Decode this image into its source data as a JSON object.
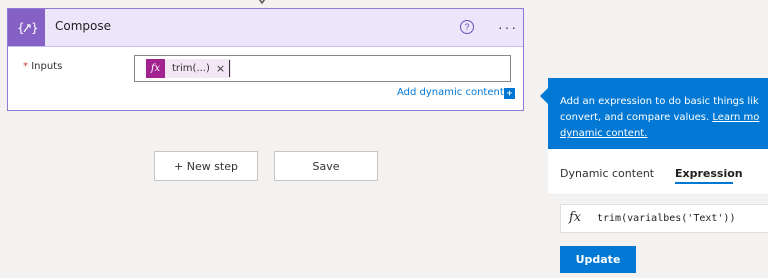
{
  "compose_card": {
    "title": "Compose",
    "help_glyph": "?",
    "more_glyph": "···",
    "inputs_label": "Inputs",
    "required_marker": "*",
    "token": {
      "icon_text": "fx",
      "label": "trim(...)",
      "remove_glyph": "×"
    },
    "add_dynamic_label": "Add dynamic content",
    "add_dynamic_glyph": "+"
  },
  "steps": {
    "new_step_label": "+ New step",
    "save_label": "Save"
  },
  "panel": {
    "description_line1": "Add an expression to do basic things lik",
    "description_line2_prefix": "convert, and compare values. ",
    "description_link_line2": "Learn mo",
    "description_link_line3": "dynamic content.",
    "tabs": [
      {
        "label": "Dynamic content",
        "active": false
      },
      {
        "label": "Expression",
        "active": true
      }
    ],
    "expression_icon": "fx",
    "expression_value": "trim(varialbes('Text'))",
    "update_label": "Update"
  },
  "colors": {
    "accent_purple": "#8661c5",
    "card_header_bg": "#ece6fb",
    "token_fx_bg": "#a2238f",
    "link_blue": "#0078d4"
  },
  "icons": {
    "header_icon": "compose-braces-icon",
    "connector": "down-arrow-icon"
  }
}
